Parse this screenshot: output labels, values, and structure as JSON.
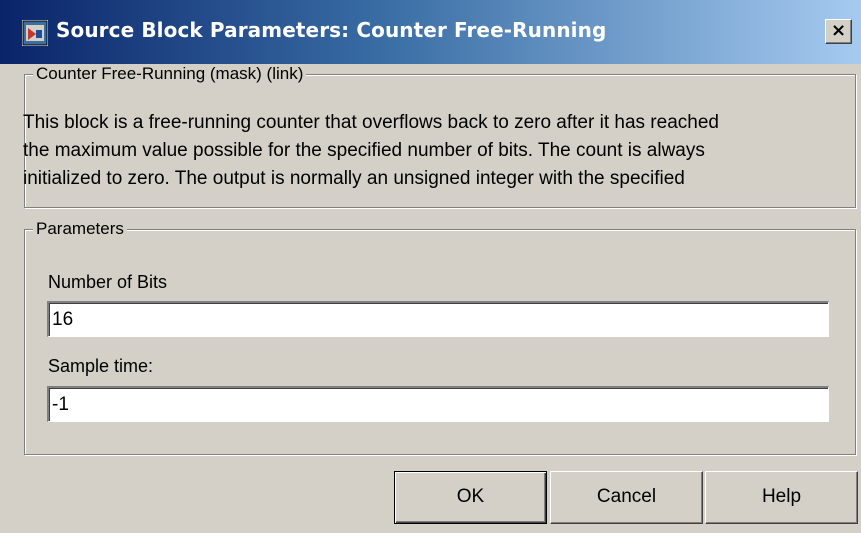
{
  "window": {
    "title": "Source Block Parameters: Counter Free-Running",
    "close_label": "×",
    "title_gradient": [
      "#0a246a",
      "#a6caf0"
    ]
  },
  "description": {
    "legend": "Counter Free-Running (mask) (link)",
    "lines": [
      "This block is a free-running counter that overflows back to zero after it has reached",
      "the maximum value possible for the specified number of bits. The count is always",
      "initialized to zero.  The output is normally an unsigned integer with the specified"
    ]
  },
  "parameters": {
    "legend": "Parameters",
    "number_of_bits": {
      "label": "Number of Bits",
      "value": "16"
    },
    "sample_time": {
      "label": "Sample time:",
      "value": "-1"
    }
  },
  "buttons": {
    "ok": "OK",
    "cancel": "Cancel",
    "help": "Help"
  }
}
